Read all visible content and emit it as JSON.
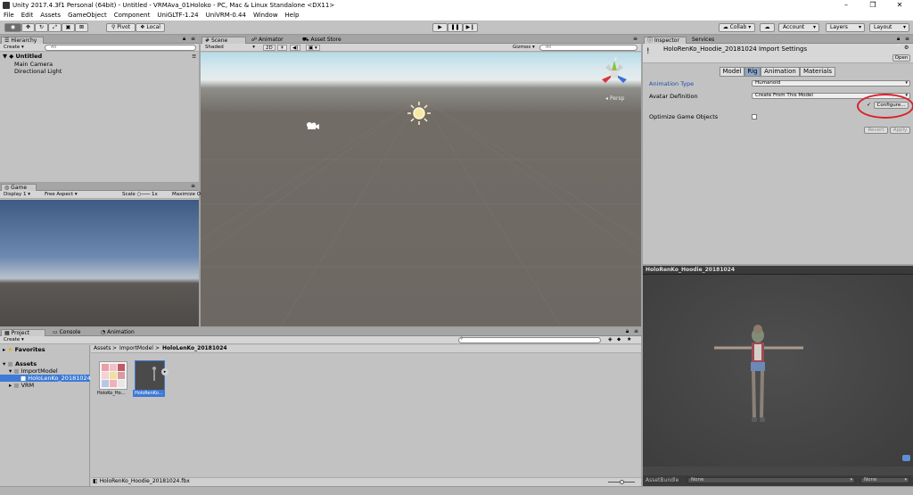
{
  "window": {
    "title": "Unity 2017.4.3f1 Personal (64bit) - Untitled - VRMAva_01Holoko - PC, Mac & Linux Standalone <DX11>",
    "controls": [
      "–",
      "❐",
      "✕"
    ]
  },
  "menu": [
    "File",
    "Edit",
    "Assets",
    "GameObject",
    "Component",
    "UniGLTF-1.24",
    "UniVRM-0.44",
    "Window",
    "Help"
  ],
  "toolbar": {
    "pivot": "Pivot",
    "local": "Local",
    "collab": "Collab ▾",
    "account": "Account",
    "layers": "Layers",
    "layout": "Layout"
  },
  "hierarchy": {
    "tab": "Hierarchy",
    "create": "Create ▾",
    "search_placeholder": "All",
    "scene_name": "Untitled",
    "items": [
      "Main Camera",
      "Directional Light"
    ]
  },
  "game": {
    "tab": "Game",
    "display": "Display 1",
    "aspect": "Free Aspect",
    "scale_label": "Scale",
    "scale_value": "1x",
    "maximize": "Maximize O"
  },
  "scene": {
    "tabs": [
      "Scene",
      "Animator",
      "Asset Store"
    ],
    "shading": "Shaded",
    "mode_2d": "2D",
    "gizmos": "Gizmos ▾",
    "search_placeholder": "All",
    "persp": "Persp",
    "axis_y": "y",
    "axis_x": "x",
    "axis_z": "z"
  },
  "project": {
    "tabs": [
      "Project",
      "Console",
      "Animation"
    ],
    "create": "Create ▾",
    "tree": {
      "favorites": "Favorites",
      "assets": "Assets",
      "import_model": "ImportModel",
      "selected_item": "HoloLenKo_20181024",
      "vrm": "VRM"
    },
    "breadcrumb": [
      "Assets",
      "ImportModel",
      "HoloLenKo_20181024"
    ],
    "breadcrumb_sep": ">",
    "assets": [
      {
        "label": "HoloKo_Ho..."
      },
      {
        "label": "HoloRenKo..."
      }
    ],
    "status_file": "HoloRenKo_Hoodie_20181024.fbx"
  },
  "inspector": {
    "tabs": [
      "Inspector",
      "Services"
    ],
    "header_title": "HoloRenKo_Hoodie_20181024 Import Settings",
    "open_button": "Open",
    "mode_tabs": [
      "Model",
      "Rig",
      "Animation",
      "Materials"
    ],
    "active_mode": "Rig",
    "animation_type_label": "Animation Type",
    "animation_type_value": "Humanoid",
    "avatar_def_label": "Avatar Definition",
    "avatar_def_value": "Create From This Model",
    "configure_check": "✓",
    "configure_button": "Configure...",
    "optimize_label": "Optimize Game Objects",
    "revert": "Revert",
    "apply": "Apply"
  },
  "preview": {
    "title": "HoloRenKo_Hoodie_20181024",
    "assetbundle_label": "AssetBundle",
    "assetbundle_value": "None",
    "variant_value": "None"
  },
  "colors": {
    "annotation_circle": "#d9202a",
    "active_blue": "#3e7ad6",
    "panel": "#c2c2c2",
    "scene_ground": "#6e6863"
  }
}
